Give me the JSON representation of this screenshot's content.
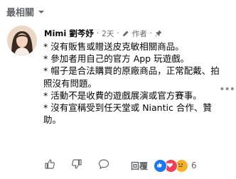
{
  "sort": {
    "label": "最相關",
    "icon": "chevron-down-icon"
  },
  "comment": {
    "author": "Mimi 劉芩妤",
    "time": "2天",
    "visibility_icon": "edit-icon",
    "role": "作者",
    "pin_icon": "pin-icon",
    "lines": [
      "* 沒有販售或贈送皮克敏相關商品。",
      "* 參加者用自己的官方 App 玩遊戲。",
      "* 帽子是合法購買的原廠商品，正常配戴、拍照沒有問題。",
      "* 活動不是收費的遊戲展演或官方賽事。",
      "* 沒有宣稱受到任天堂或 Niantic 合作、贊助。"
    ]
  },
  "actions": {
    "like_icon": "thumbs-up-icon",
    "dislike_icon": "thumbs-down-icon",
    "comment_icon": "comment-bubble-icon",
    "reply_label": "回覆",
    "reactions": [
      "like",
      "love",
      "sad"
    ],
    "reaction_count": "6"
  },
  "more_icon": "more-dots-icon",
  "colors": {
    "like": "#1877f2",
    "love": "#f33e58",
    "sad": "#f7b125",
    "muted": "#65676b"
  }
}
